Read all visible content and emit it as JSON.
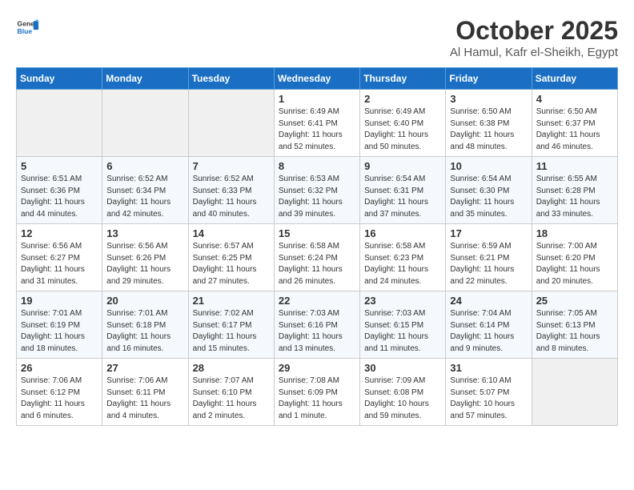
{
  "header": {
    "logo_general": "General",
    "logo_blue": "Blue",
    "month_title": "October 2025",
    "location": "Al Hamul, Kafr el-Sheikh, Egypt"
  },
  "days_of_week": [
    "Sunday",
    "Monday",
    "Tuesday",
    "Wednesday",
    "Thursday",
    "Friday",
    "Saturday"
  ],
  "weeks": [
    [
      {
        "day": "",
        "content": ""
      },
      {
        "day": "",
        "content": ""
      },
      {
        "day": "",
        "content": ""
      },
      {
        "day": "1",
        "content": "Sunrise: 6:49 AM\nSunset: 6:41 PM\nDaylight: 11 hours\nand 52 minutes."
      },
      {
        "day": "2",
        "content": "Sunrise: 6:49 AM\nSunset: 6:40 PM\nDaylight: 11 hours\nand 50 minutes."
      },
      {
        "day": "3",
        "content": "Sunrise: 6:50 AM\nSunset: 6:38 PM\nDaylight: 11 hours\nand 48 minutes."
      },
      {
        "day": "4",
        "content": "Sunrise: 6:50 AM\nSunset: 6:37 PM\nDaylight: 11 hours\nand 46 minutes."
      }
    ],
    [
      {
        "day": "5",
        "content": "Sunrise: 6:51 AM\nSunset: 6:36 PM\nDaylight: 11 hours\nand 44 minutes."
      },
      {
        "day": "6",
        "content": "Sunrise: 6:52 AM\nSunset: 6:34 PM\nDaylight: 11 hours\nand 42 minutes."
      },
      {
        "day": "7",
        "content": "Sunrise: 6:52 AM\nSunset: 6:33 PM\nDaylight: 11 hours\nand 40 minutes."
      },
      {
        "day": "8",
        "content": "Sunrise: 6:53 AM\nSunset: 6:32 PM\nDaylight: 11 hours\nand 39 minutes."
      },
      {
        "day": "9",
        "content": "Sunrise: 6:54 AM\nSunset: 6:31 PM\nDaylight: 11 hours\nand 37 minutes."
      },
      {
        "day": "10",
        "content": "Sunrise: 6:54 AM\nSunset: 6:30 PM\nDaylight: 11 hours\nand 35 minutes."
      },
      {
        "day": "11",
        "content": "Sunrise: 6:55 AM\nSunset: 6:28 PM\nDaylight: 11 hours\nand 33 minutes."
      }
    ],
    [
      {
        "day": "12",
        "content": "Sunrise: 6:56 AM\nSunset: 6:27 PM\nDaylight: 11 hours\nand 31 minutes."
      },
      {
        "day": "13",
        "content": "Sunrise: 6:56 AM\nSunset: 6:26 PM\nDaylight: 11 hours\nand 29 minutes."
      },
      {
        "day": "14",
        "content": "Sunrise: 6:57 AM\nSunset: 6:25 PM\nDaylight: 11 hours\nand 27 minutes."
      },
      {
        "day": "15",
        "content": "Sunrise: 6:58 AM\nSunset: 6:24 PM\nDaylight: 11 hours\nand 26 minutes."
      },
      {
        "day": "16",
        "content": "Sunrise: 6:58 AM\nSunset: 6:23 PM\nDaylight: 11 hours\nand 24 minutes."
      },
      {
        "day": "17",
        "content": "Sunrise: 6:59 AM\nSunset: 6:21 PM\nDaylight: 11 hours\nand 22 minutes."
      },
      {
        "day": "18",
        "content": "Sunrise: 7:00 AM\nSunset: 6:20 PM\nDaylight: 11 hours\nand 20 minutes."
      }
    ],
    [
      {
        "day": "19",
        "content": "Sunrise: 7:01 AM\nSunset: 6:19 PM\nDaylight: 11 hours\nand 18 minutes."
      },
      {
        "day": "20",
        "content": "Sunrise: 7:01 AM\nSunset: 6:18 PM\nDaylight: 11 hours\nand 16 minutes."
      },
      {
        "day": "21",
        "content": "Sunrise: 7:02 AM\nSunset: 6:17 PM\nDaylight: 11 hours\nand 15 minutes."
      },
      {
        "day": "22",
        "content": "Sunrise: 7:03 AM\nSunset: 6:16 PM\nDaylight: 11 hours\nand 13 minutes."
      },
      {
        "day": "23",
        "content": "Sunrise: 7:03 AM\nSunset: 6:15 PM\nDaylight: 11 hours\nand 11 minutes."
      },
      {
        "day": "24",
        "content": "Sunrise: 7:04 AM\nSunset: 6:14 PM\nDaylight: 11 hours\nand 9 minutes."
      },
      {
        "day": "25",
        "content": "Sunrise: 7:05 AM\nSunset: 6:13 PM\nDaylight: 11 hours\nand 8 minutes."
      }
    ],
    [
      {
        "day": "26",
        "content": "Sunrise: 7:06 AM\nSunset: 6:12 PM\nDaylight: 11 hours\nand 6 minutes."
      },
      {
        "day": "27",
        "content": "Sunrise: 7:06 AM\nSunset: 6:11 PM\nDaylight: 11 hours\nand 4 minutes."
      },
      {
        "day": "28",
        "content": "Sunrise: 7:07 AM\nSunset: 6:10 PM\nDaylight: 11 hours\nand 2 minutes."
      },
      {
        "day": "29",
        "content": "Sunrise: 7:08 AM\nSunset: 6:09 PM\nDaylight: 11 hours\nand 1 minute."
      },
      {
        "day": "30",
        "content": "Sunrise: 7:09 AM\nSunset: 6:08 PM\nDaylight: 10 hours\nand 59 minutes."
      },
      {
        "day": "31",
        "content": "Sunrise: 6:10 AM\nSunset: 5:07 PM\nDaylight: 10 hours\nand 57 minutes."
      },
      {
        "day": "",
        "content": ""
      }
    ]
  ]
}
